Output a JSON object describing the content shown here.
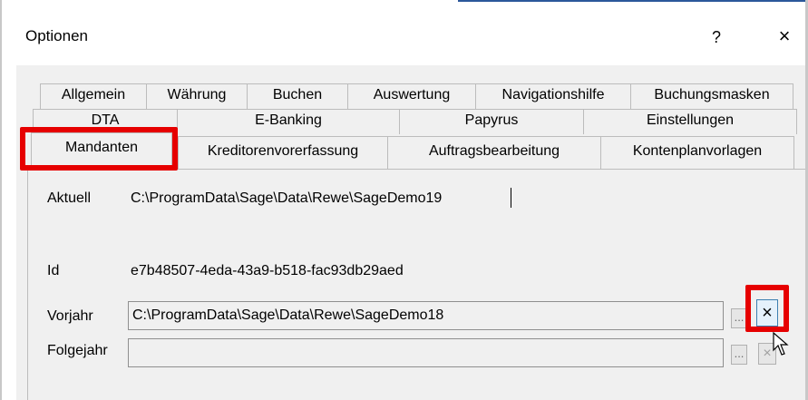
{
  "window": {
    "title": "Optionen",
    "help_glyph": "?",
    "close_glyph": "×"
  },
  "tabs": {
    "row1": [
      "Allgemein",
      "Währung",
      "Buchen",
      "Auswertung",
      "Navigationshilfe",
      "Buchungsmasken"
    ],
    "row2": [
      "DTA",
      "E-Banking",
      "Papyrus",
      "Einstellungen"
    ],
    "row3": [
      "Mandanten",
      "Kreditorenvorerfassung",
      "Auftragsbearbeitung",
      "Kontenplanvorlagen"
    ],
    "active": "Mandanten"
  },
  "mandanten": {
    "aktuell_label": "Aktuell",
    "aktuell_value": "C:\\ProgramData\\Sage\\Data\\Rewe\\SageDemo19",
    "id_label": "Id",
    "id_value": "e7b48507-4eda-43a9-b518-fac93db29aed",
    "vorjahr_label": "Vorjahr",
    "vorjahr_value": "C:\\ProgramData\\Sage\\Data\\Rewe\\SageDemo18",
    "folgejahr_label": "Folgejahr",
    "folgejahr_value": "",
    "browse_glyph": "...",
    "clear_glyph": "×"
  },
  "highlight_color": "#e60000"
}
